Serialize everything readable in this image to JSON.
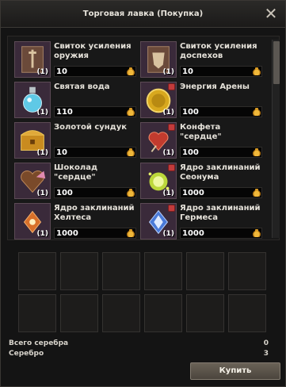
{
  "window": {
    "title": "Торговая лавка (Покупка)"
  },
  "items": [
    {
      "name": "Свиток усиления оружия",
      "qty": "(1)",
      "price": "10",
      "icon": "weapon-scroll-icon",
      "locked": false
    },
    {
      "name": "Свиток усиления доспехов",
      "qty": "(1)",
      "price": "10",
      "icon": "armor-scroll-icon",
      "locked": false
    },
    {
      "name": "Святая вода",
      "qty": "(1)",
      "price": "110",
      "icon": "holy-water-icon",
      "locked": false
    },
    {
      "name": "Энергия Арены",
      "qty": "(1)",
      "price": "100",
      "icon": "arena-energy-coin-icon",
      "locked": true
    },
    {
      "name": "Золотой сундук",
      "qty": "(1)",
      "price": "10",
      "icon": "golden-chest-icon",
      "locked": false
    },
    {
      "name": "Конфета \"сердце\"",
      "qty": "(1)",
      "price": "100",
      "icon": "heart-candy-icon",
      "locked": true
    },
    {
      "name": "Шоколад \"сердце\"",
      "qty": "(1)",
      "price": "100",
      "icon": "heart-chocolate-icon",
      "locked": false
    },
    {
      "name": "Ядро заклинаний Сеонума",
      "qty": "(1)",
      "price": "1000",
      "icon": "seonum-spell-core-icon",
      "locked": true
    },
    {
      "name": "Ядро заклинаний Хелтеса",
      "qty": "(1)",
      "price": "1000",
      "icon": "heltes-spell-core-icon",
      "locked": false
    },
    {
      "name": "Ядро заклинаний Гермеса",
      "qty": "(1)",
      "price": "1000",
      "icon": "hermes-spell-core-icon",
      "locked": true
    }
  ],
  "totals": {
    "total_silver_label": "Всего серебра",
    "total_silver_value": "0",
    "silver_label": "Серебро",
    "silver_value": "3"
  },
  "buy_button": "Купить",
  "colors": {
    "accent": "#d89a24",
    "lock": "#c23b3b"
  }
}
